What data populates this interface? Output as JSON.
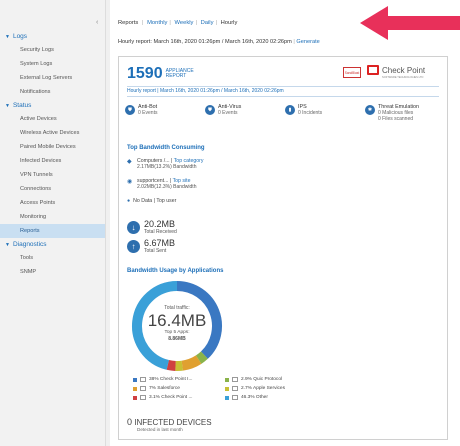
{
  "sidebar": {
    "collapse_glyph": "‹",
    "logs": {
      "label": "Logs",
      "items": [
        "Security Logs",
        "System Logs",
        "External Log Servers",
        "Notifications"
      ]
    },
    "status": {
      "label": "Status",
      "items": [
        "Active Devices",
        "Wireless Active Devices",
        "Paired Mobile Devices",
        "Infected Devices",
        "VPN Tunnels",
        "Connections",
        "Access Points",
        "Monitoring",
        "Reports"
      ]
    },
    "diagnostics": {
      "label": "Diagnostics",
      "items": [
        "Tools",
        "SNMP"
      ]
    }
  },
  "topnav": {
    "reports": "Reports",
    "monthly": "Monthly",
    "weekly": "Weekly",
    "daily": "Daily",
    "hourly": "Hourly"
  },
  "report_header": {
    "range": "Hourly report: March 16th, 2020 01:26pm / March 16th, 2020 02:26pm",
    "generate": "Generate"
  },
  "report": {
    "number": "1590",
    "appliance": "APPLIANCE",
    "report": "REPORT",
    "badge": "SandBlast",
    "brand": "Check Point",
    "brand_tagline": "SOFTWARE TECHNOLOGIES LTD",
    "hourly_range": "Hourly report | March 16th, 2020 01:26pm / March 16th, 2020 02:26pm",
    "threats": [
      {
        "name": "Anti-Bot",
        "value": "0 Events",
        "extra": ""
      },
      {
        "name": "Anti-Virus",
        "value": "0 Events",
        "extra": ""
      },
      {
        "name": "IPS",
        "value": "0 Incidents",
        "extra": ""
      },
      {
        "name": "Threat Emulation",
        "value": "0 Malicious files",
        "extra": "0 Files scanned"
      }
    ],
    "top_bandwidth_title": "Top Bandwidth Consuming",
    "categories": {
      "name": "Computers /...",
      "link": "Top category",
      "value": "2.17MB(13.2%) Bandwidth"
    },
    "sites": {
      "name": "supportcent...",
      "link": "Top site",
      "value": "2.02MB(12.3%) Bandwidth"
    },
    "user": {
      "no_data": "No Data",
      "link": "Top user"
    },
    "received": {
      "value": "20.2MB",
      "label": "Total Received"
    },
    "sent": {
      "value": "6.67MB",
      "label": "Total Sent"
    },
    "apps_title": "Bandwidth Usage by Applications",
    "donut": {
      "total_label": "Total traffic:",
      "total_value": "16.4MB",
      "apps_label": "Top 5 Apps:",
      "apps_value": "8.86MB"
    },
    "legend": [
      {
        "label": "38% Check Point I...",
        "color": "#3a78c2",
        "pct": 38
      },
      {
        "label": "2.9% Quic Protocol",
        "color": "#8ab34a",
        "pct": 2.9
      },
      {
        "label": "7% Salesforce",
        "color": "#e0a030",
        "pct": 7
      },
      {
        "label": "2.7% Apple Services",
        "color": "#c8c034",
        "pct": 2.7
      },
      {
        "label": "3.1% Check Point ...",
        "color": "#d04040",
        "pct": 3.1
      },
      {
        "label": "46.3% Other",
        "color": "#3aa0d8",
        "pct": 46.3
      }
    ],
    "infected": {
      "count": "0",
      "label": "INFECTED DEVICES",
      "sub": "Detected in last month"
    }
  },
  "colors": {
    "accent": "#1d6fb8",
    "arrow": "#e8305a",
    "active_row": "#c9dff2"
  }
}
